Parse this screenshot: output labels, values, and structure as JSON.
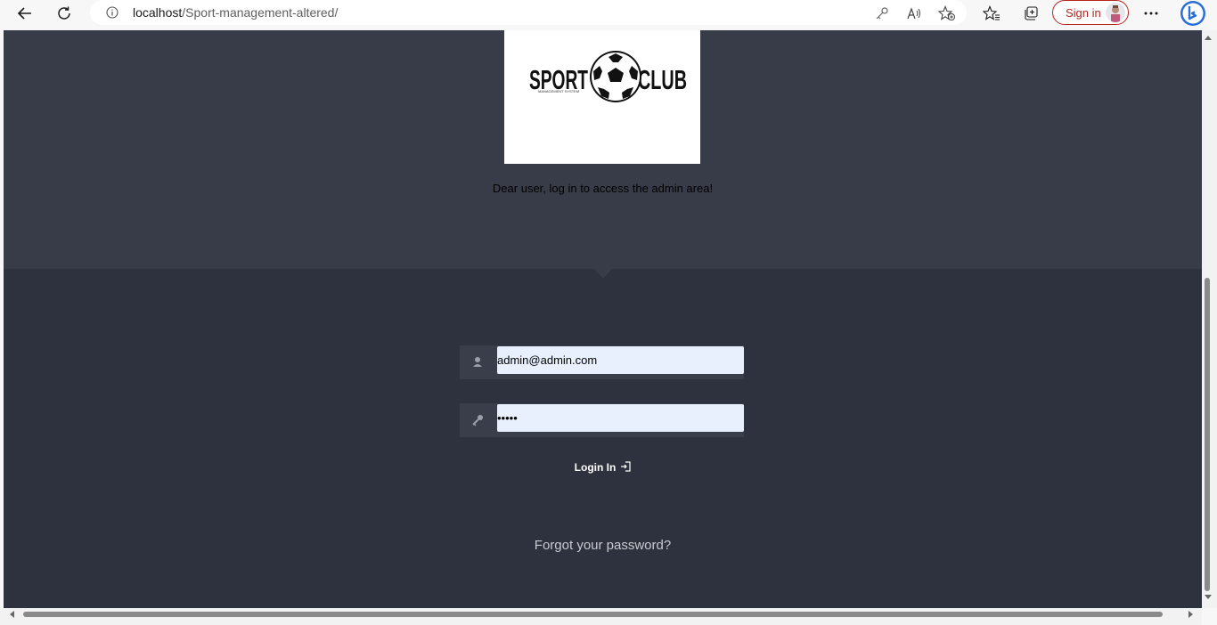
{
  "browser": {
    "url_host": "localhost",
    "url_path": "/Sport-management-altered/",
    "sign_in_label": "Sign in",
    "icons": [
      "back-icon",
      "refresh-icon",
      "info-icon",
      "key-icon",
      "read-aloud-icon",
      "add-favorite-icon",
      "favorites-icon",
      "collections-icon",
      "more-icon",
      "bing-icon"
    ]
  },
  "logo": {
    "text_left": "SPORT",
    "text_right": "CLUB",
    "subtitle": "MANAGEMENT SYSTEM"
  },
  "welcome_text": "Dear user, log in to access the admin area!",
  "form": {
    "email_value": "admin@admin.com",
    "password_value": "•••••",
    "login_label": "Login In",
    "forgot_label": "Forgot your password?"
  },
  "colors": {
    "hero_bg": "#383c48",
    "panel_bg": "#2e323e",
    "input_bg": "#e8f0fe",
    "signin_accent": "#b3261e"
  }
}
